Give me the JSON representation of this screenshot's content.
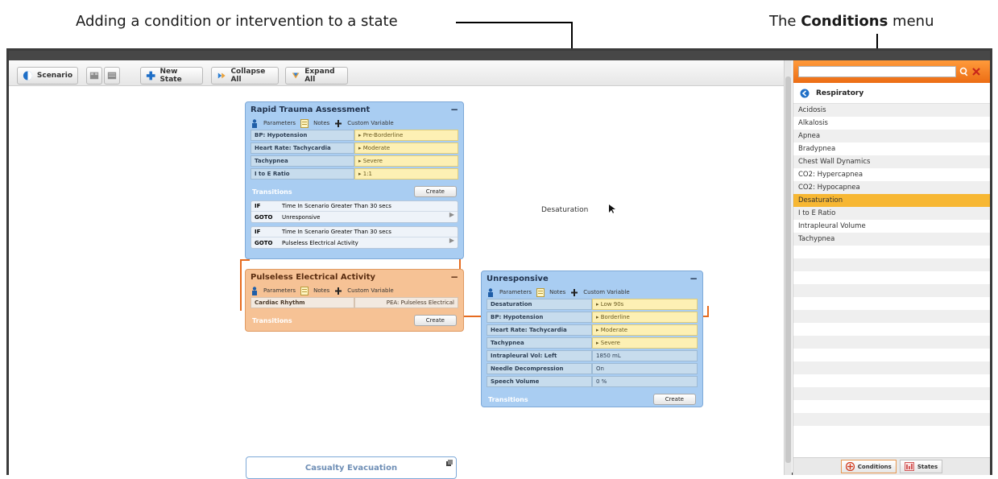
{
  "annotations": {
    "left": "Adding a condition or intervention to a state",
    "right_prefix": "The ",
    "right_bold": "Conditions",
    "right_suffix": " menu"
  },
  "toolbar": {
    "scenario": "Scenario",
    "new_state": "New State",
    "collapse_all": "Collapse All",
    "expand_all": "Expand All"
  },
  "common": {
    "parameters": "Parameters",
    "notes": "Notes",
    "custom_variable": "Custom Variable",
    "transitions": "Transitions",
    "create": "Create",
    "if": "IF",
    "goto": "GOTO",
    "minimize": "−"
  },
  "states": {
    "rapid": {
      "title": "Rapid Trauma Assessment",
      "params": [
        {
          "name": "BP: Hypotension",
          "value": "Pre-Borderline"
        },
        {
          "name": "Heart Rate: Tachycardia",
          "value": "Moderate"
        },
        {
          "name": "Tachypnea",
          "value": "Severe"
        },
        {
          "name": "I to E Ratio",
          "value": "1:1"
        }
      ],
      "transitions": [
        {
          "if": "Time In Scenario Greater Than 30 secs",
          "goto": "Unresponsive"
        },
        {
          "if": "Time In Scenario Greater Than 30 secs",
          "goto": "Pulseless Electrical Activity"
        }
      ]
    },
    "pea": {
      "title": "Pulseless Electrical Activity",
      "params": [
        {
          "name": "Cardiac Rhythm",
          "value": "PEA: Pulseless Electrical"
        }
      ]
    },
    "unresponsive": {
      "title": "Unresponsive",
      "params": [
        {
          "name": "Desaturation",
          "value": "Low 90s"
        },
        {
          "name": "BP: Hypotension",
          "value": "Borderline"
        },
        {
          "name": "Heart Rate: Tachycardia",
          "value": "Moderate"
        },
        {
          "name": "Tachypnea",
          "value": "Severe"
        },
        {
          "name": "Intrapleural Vol: Left",
          "value": "1850 mL"
        },
        {
          "name": "Needle Decompression",
          "value": "On"
        },
        {
          "name": "Speech Volume",
          "value": "0 %"
        }
      ]
    },
    "casualty": {
      "title": "Casualty Evacuation"
    }
  },
  "drag_label": "Desaturation",
  "panel": {
    "search_value": "",
    "category": "Respiratory",
    "items": [
      "Acidosis",
      "Alkalosis",
      "Apnea",
      "Bradypnea",
      "Chest Wall Dynamics",
      "CO2: Hypercapnea",
      "CO2: Hypocapnea",
      "Desaturation",
      "I to E Ratio",
      "Intrapleural Volume",
      "Tachypnea"
    ],
    "selected": "Desaturation",
    "tabs": {
      "conditions": "Conditions",
      "states": "States"
    }
  },
  "colors": {
    "accent": "#ec6d14",
    "state_blue": "#a9cdf2",
    "state_orange": "#f6c295",
    "selected_item": "#f7b733"
  }
}
